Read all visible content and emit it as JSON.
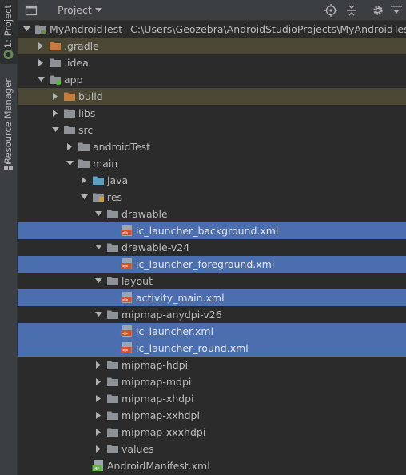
{
  "stripe": {
    "project_tab": "1: Project",
    "resource_tab": "Resource Manager"
  },
  "header": {
    "title": "Project"
  },
  "tree": {
    "root": {
      "label": "MyAndroidTest",
      "path": "C:\\Users\\Geozebra\\AndroidStudioProjects\\MyAndroidTest"
    },
    "items": [
      {
        "label": ".gradle"
      },
      {
        "label": ".idea"
      },
      {
        "label": "app"
      },
      {
        "label": "build"
      },
      {
        "label": "libs"
      },
      {
        "label": "src"
      },
      {
        "label": "androidTest"
      },
      {
        "label": "main"
      },
      {
        "label": "java"
      },
      {
        "label": "res"
      },
      {
        "label": "drawable"
      },
      {
        "label": "ic_launcher_background.xml"
      },
      {
        "label": "drawable-v24"
      },
      {
        "label": "ic_launcher_foreground.xml"
      },
      {
        "label": "layout"
      },
      {
        "label": "activity_main.xml"
      },
      {
        "label": "mipmap-anydpi-v26"
      },
      {
        "label": "ic_launcher.xml"
      },
      {
        "label": "ic_launcher_round.xml"
      },
      {
        "label": "mipmap-hdpi"
      },
      {
        "label": "mipmap-mdpi"
      },
      {
        "label": "mipmap-xhdpi"
      },
      {
        "label": "mipmap-xxhdpi"
      },
      {
        "label": "mipmap-xxxhdpi"
      },
      {
        "label": "values"
      },
      {
        "label": "AndroidManifest.xml"
      }
    ]
  },
  "colors": {
    "background": "#2b2b2b",
    "selection": "#4b6eaf",
    "excluded_row": "#4b4735",
    "folder": "#8e9196",
    "excluded_folder": "#c97a3e",
    "source_folder": "#5b9fc4"
  }
}
